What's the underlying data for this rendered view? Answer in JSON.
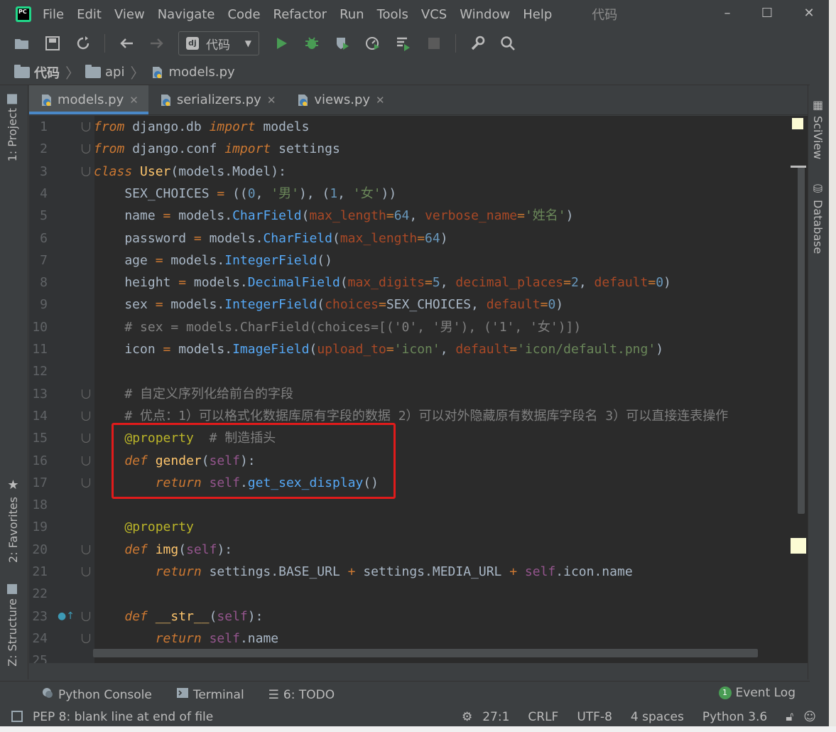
{
  "app": {
    "title": "代码"
  },
  "menu": [
    "File",
    "Edit",
    "View",
    "Navigate",
    "Code",
    "Refactor",
    "Run",
    "Tools",
    "VCS",
    "Window",
    "Help"
  ],
  "toolbar": {
    "run_config": "代码"
  },
  "breadcrumb": [
    "代码",
    "api",
    "models.py"
  ],
  "tabs": [
    {
      "label": "models.py",
      "active": true
    },
    {
      "label": "serializers.py",
      "active": false
    },
    {
      "label": "views.py",
      "active": false
    }
  ],
  "left_tools": [
    "1: Project",
    "2: Favorites",
    "Z: Structure"
  ],
  "right_tools": [
    "SciView",
    "Database"
  ],
  "code_lines": [
    {
      "n": "1"
    },
    {
      "n": "2"
    },
    {
      "n": "3"
    },
    {
      "n": "4"
    },
    {
      "n": "5"
    },
    {
      "n": "6"
    },
    {
      "n": "7"
    },
    {
      "n": "8"
    },
    {
      "n": "9"
    },
    {
      "n": "10"
    },
    {
      "n": "11"
    },
    {
      "n": "12"
    },
    {
      "n": "13"
    },
    {
      "n": "14"
    },
    {
      "n": "15"
    },
    {
      "n": "16"
    },
    {
      "n": "17"
    },
    {
      "n": "18"
    },
    {
      "n": "19"
    },
    {
      "n": "20"
    },
    {
      "n": "21"
    },
    {
      "n": "22"
    },
    {
      "n": "23"
    },
    {
      "n": "24"
    },
    {
      "n": "25"
    }
  ],
  "bottom_tools": [
    "Python Console",
    "Terminal",
    "6: TODO"
  ],
  "event_log": {
    "label": "Event Log",
    "count": "1"
  },
  "status": {
    "message": "PEP 8: blank line at end of file",
    "position": "27:1",
    "line_sep": "CRLF",
    "encoding": "UTF-8",
    "indent": "4 spaces",
    "interpreter": "Python 3.6"
  },
  "colors": {
    "accent": "#4a88c7",
    "highlight_box": "#e01b1b",
    "editor_bg": "#2b2b2b"
  }
}
